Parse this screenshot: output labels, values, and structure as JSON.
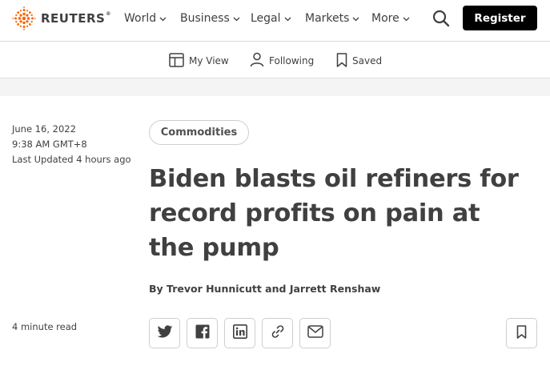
{
  "header": {
    "logo_text": "REUTERS",
    "logo_reg": "®",
    "nav": [
      {
        "label": "World"
      },
      {
        "label": "Business"
      },
      {
        "label": "Legal"
      },
      {
        "label": "Markets"
      },
      {
        "label": "More"
      }
    ],
    "register_label": "Register",
    "brand_color": "#fa6400"
  },
  "subnav": {
    "my_view": "My View",
    "following": "Following",
    "saved": "Saved"
  },
  "article": {
    "date": "June 16, 2022",
    "time": "9:38 AM GMT+8",
    "last_updated": "Last Updated 4 hours ago",
    "tag": "Commodities",
    "headline": "Biden blasts oil refiners for record profits on pain at the pump",
    "byline_prefix": "By",
    "author1": "Trevor Hunnicutt",
    "byline_and": "and",
    "author2": "Jarrett Renshaw",
    "read_time": "4 minute read"
  },
  "share": {
    "icons": [
      "twitter-icon",
      "facebook-icon",
      "linkedin-icon",
      "link-icon",
      "email-icon"
    ],
    "bookmark_icon": "bookmark-icon"
  }
}
